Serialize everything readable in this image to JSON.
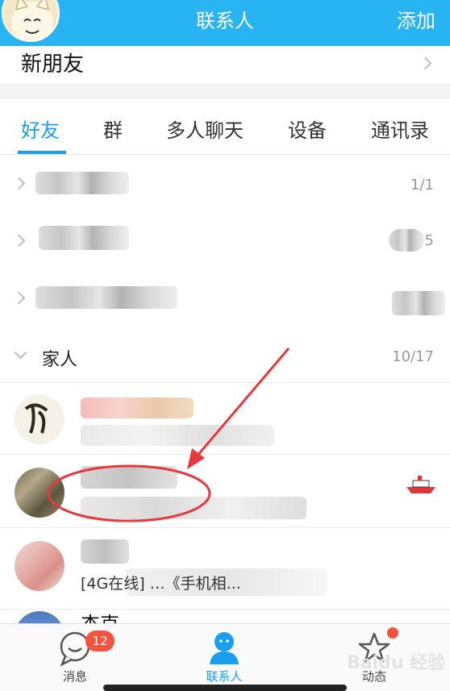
{
  "header": {
    "title": "联系人",
    "add_label": "添加"
  },
  "new_friend": {
    "label": "新朋友"
  },
  "tabs": [
    {
      "label": "好友",
      "active": true
    },
    {
      "label": "群",
      "active": false
    },
    {
      "label": "多人聊天",
      "active": false
    },
    {
      "label": "设备",
      "active": false
    },
    {
      "label": "通讯录",
      "active": false
    }
  ],
  "groups": [
    {
      "label": "",
      "count": "1/1",
      "expanded": false
    },
    {
      "label": "",
      "count": "5",
      "expanded": false
    },
    {
      "label": "",
      "count": "",
      "expanded": false
    },
    {
      "label": "家人",
      "count": "10/17",
      "expanded": true
    }
  ],
  "contacts": [
    {
      "preview": ""
    },
    {
      "preview": ""
    },
    {
      "preview": "[4G在线] …《手机相..."
    },
    {
      "preview": "杰克"
    }
  ],
  "tabbar": {
    "messages": {
      "label": "消息",
      "badge": "12"
    },
    "contacts": {
      "label": "联系人"
    },
    "feed": {
      "label": "动态"
    }
  },
  "watermark": "Baidu 经验",
  "colors": {
    "accent": "#28b4f2",
    "active_tab": "#1a9ff0",
    "badge": "#f5533d",
    "annotation": "#e8383d"
  }
}
